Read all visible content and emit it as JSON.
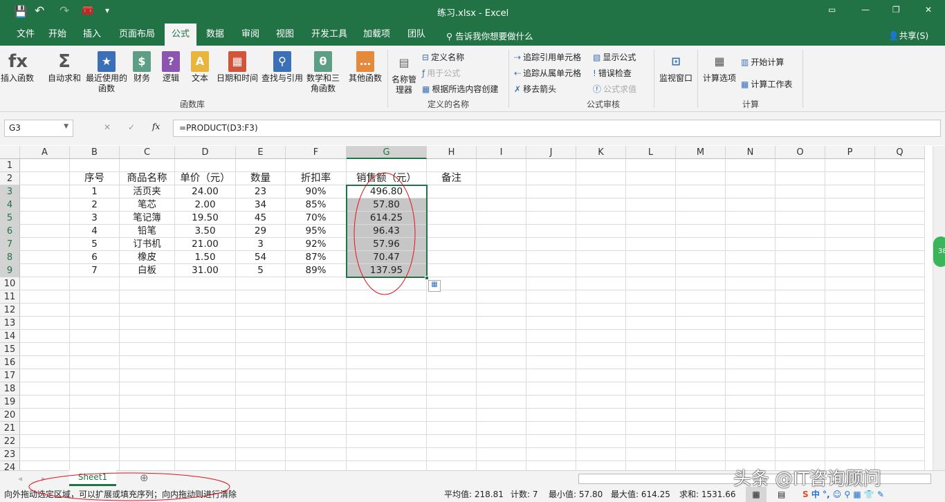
{
  "title": "练习.xlsx  -  Excel",
  "qat": {
    "save": "save-icon",
    "undo": "undo-icon",
    "redo": "redo-icon",
    "more": "▾"
  },
  "window_controls": {
    "ribbon_opts": "▭",
    "min": "—",
    "max": "❐",
    "close": "✕"
  },
  "tabs": [
    "文件",
    "开始",
    "插入",
    "页面布局",
    "公式",
    "数据",
    "审阅",
    "视图",
    "开发工具",
    "加载项",
    "团队"
  ],
  "active_tab": "公式",
  "tell_me": "告诉我你想要做什么",
  "share": "共享(S)",
  "ribbon": {
    "library": {
      "label": "函数库",
      "items": [
        "插入函数",
        "自动求和",
        "最近使用的函数",
        "财务",
        "逻辑",
        "文本",
        "日期和时间",
        "查找与引用",
        "数学和三角函数",
        "其他函数"
      ]
    },
    "names": {
      "label": "定义的名称",
      "manager": "名称管理器",
      "define": "定义名称",
      "use": "用于公式",
      "create": "根据所选内容创建"
    },
    "audit": {
      "label": "公式审核",
      "trace_prec": "追踪引用单元格",
      "trace_dep": "追踪从属单元格",
      "remove": "移去箭头",
      "show": "显示公式",
      "error": "错误检查",
      "eval": "公式求值",
      "watch": "监视窗口"
    },
    "calc": {
      "label": "计算",
      "options": "计算选项",
      "now": "开始计算",
      "sheet": "计算工作表"
    }
  },
  "name_box": "G3",
  "formula": "=PRODUCT(D3:F3)",
  "columns": [
    "A",
    "B",
    "C",
    "D",
    "E",
    "F",
    "G",
    "H",
    "I",
    "J",
    "K",
    "L",
    "M",
    "N",
    "O",
    "P",
    "Q"
  ],
  "selected_column": "G",
  "rows": 24,
  "headers": [
    "序号",
    "商品名称",
    "单价（元）",
    "数量",
    "折扣率",
    "销售额（元）",
    "备注"
  ],
  "table": [
    [
      "1",
      "活页夹",
      "24.00",
      "23",
      "90%",
      "496.80"
    ],
    [
      "2",
      "笔芯",
      "2.00",
      "34",
      "85%",
      "57.80"
    ],
    [
      "3",
      "笔记簿",
      "19.50",
      "45",
      "70%",
      "614.25"
    ],
    [
      "4",
      "铅笔",
      "3.50",
      "29",
      "95%",
      "96.43"
    ],
    [
      "5",
      "订书机",
      "21.00",
      "3",
      "92%",
      "57.96"
    ],
    [
      "6",
      "橡皮",
      "1.50",
      "54",
      "87%",
      "70.47"
    ],
    [
      "7",
      "白板",
      "31.00",
      "5",
      "89%",
      "137.95"
    ]
  ],
  "sheet_tab": "Sheet1",
  "status": {
    "message": "向外拖动选定区域，可以扩展或填充序列；向内拖动则进行清除",
    "avg": "平均值: 218.81",
    "count": "计数: 7",
    "min": "最小值: 57.80",
    "max": "最大值: 614.25",
    "sum": "求和: 1531.66"
  },
  "watermark": "头条 @IT咨询顾问",
  "side_badge": "38",
  "colors": {
    "accent": "#217346",
    "selection_fill": "#c6c6c6",
    "annotation": "#e0141e"
  }
}
